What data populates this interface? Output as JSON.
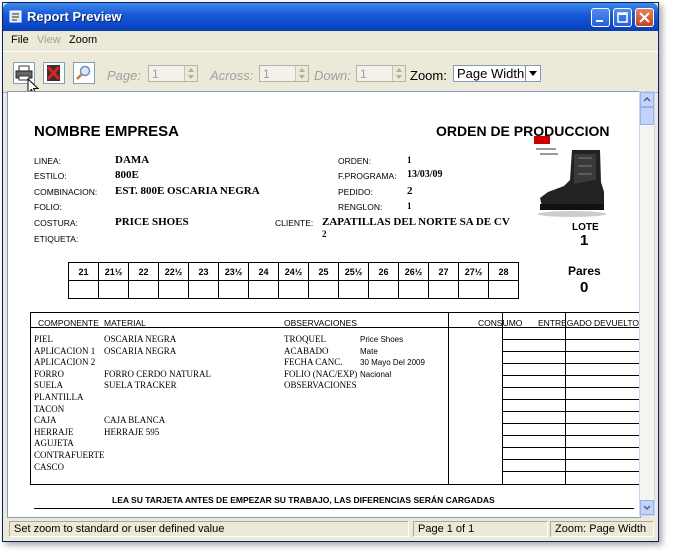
{
  "window": {
    "title": "Report Preview"
  },
  "menu": {
    "file": "File",
    "view": "View",
    "zoom": "Zoom"
  },
  "toolbar": {
    "page_label": "Page:",
    "page_value": "1",
    "across_label": "Across:",
    "across_value": "1",
    "down_label": "Down:",
    "down_value": "1",
    "zoom_label": "Zoom:",
    "zoom_value": "Page Width"
  },
  "report": {
    "company": "NOMBRE EMPRESA",
    "doc_title": "ORDEN DE PRODUCCION",
    "linea_label": "LINEA:",
    "linea": "DAMA",
    "estilo_label": "ESTILO:",
    "estilo": "800E",
    "combinacion_label": "COMBINACION:",
    "combinacion": "EST. 800E OSCARIA NEGRA",
    "folio_label": "FOLIO:",
    "costura_label": "COSTURA:",
    "costura": "PRICE SHOES",
    "etiqueta_label": "ETIQUETA:",
    "orden_label": "ORDEN:",
    "orden": "1",
    "fprograma_label": "F.PROGRAMA:",
    "fprograma": "13/03/09",
    "pedido_label": "PEDIDO:",
    "pedido": "2",
    "renglon_label": "RENGLON:",
    "renglon": "1",
    "cliente_label": "CLIENTE:",
    "cliente": "ZAPATILLAS DEL NORTE SA DE CV",
    "cliente_num": "2",
    "lote_label": "LOTE",
    "lote": "1",
    "pares_label": "Pares",
    "pares": "0",
    "sizes": [
      "21",
      "21½",
      "22",
      "22½",
      "23",
      "23½",
      "24",
      "24½",
      "25",
      "25½",
      "26",
      "26½",
      "27",
      "27½",
      "28"
    ],
    "headers": {
      "componente": "COMPONENTE",
      "material": "MATERIAL",
      "observaciones": "OBSERVACIONES",
      "consumo": "CONSUMO",
      "entregado": "ENTREGADO",
      "devuelto": "DEVUELTO"
    },
    "components": [
      "PIEL",
      "APLICACION 1",
      "APLICACION 2",
      "FORRO",
      "SUELA",
      "PLANTILLA",
      "TACON",
      "CAJA",
      "HERRAJE",
      "AGUJETA",
      "CONTRAFUERTE",
      "CASCO"
    ],
    "materials": [
      "OSCARIA NEGRA",
      "OSCARIA NEGRA",
      "",
      "FORRO CERDO NATURAL",
      "SUELA TRACKER",
      "",
      "",
      "CAJA BLANCA",
      "HERRAJE 595",
      "",
      "",
      ""
    ],
    "obs_labels": [
      "TROQUEL",
      "ACABADO",
      "FECHA CANC.",
      "FOLIO (NAC/EXP)",
      "OBSERVACIONES"
    ],
    "obs_values": [
      "Price Shoes",
      "Mate",
      "30 Mayo Del 2009",
      "Nacional",
      ""
    ],
    "footer": "LEA SU TARJETA ANTES DE EMPEZAR SU TRABAJO, LAS DIFERENCIAS SERÁN CARGADAS"
  },
  "status": {
    "hint": "Set zoom to standard or user defined value",
    "page": "Page 1 of 1",
    "zoom": "Zoom: Page Width"
  }
}
